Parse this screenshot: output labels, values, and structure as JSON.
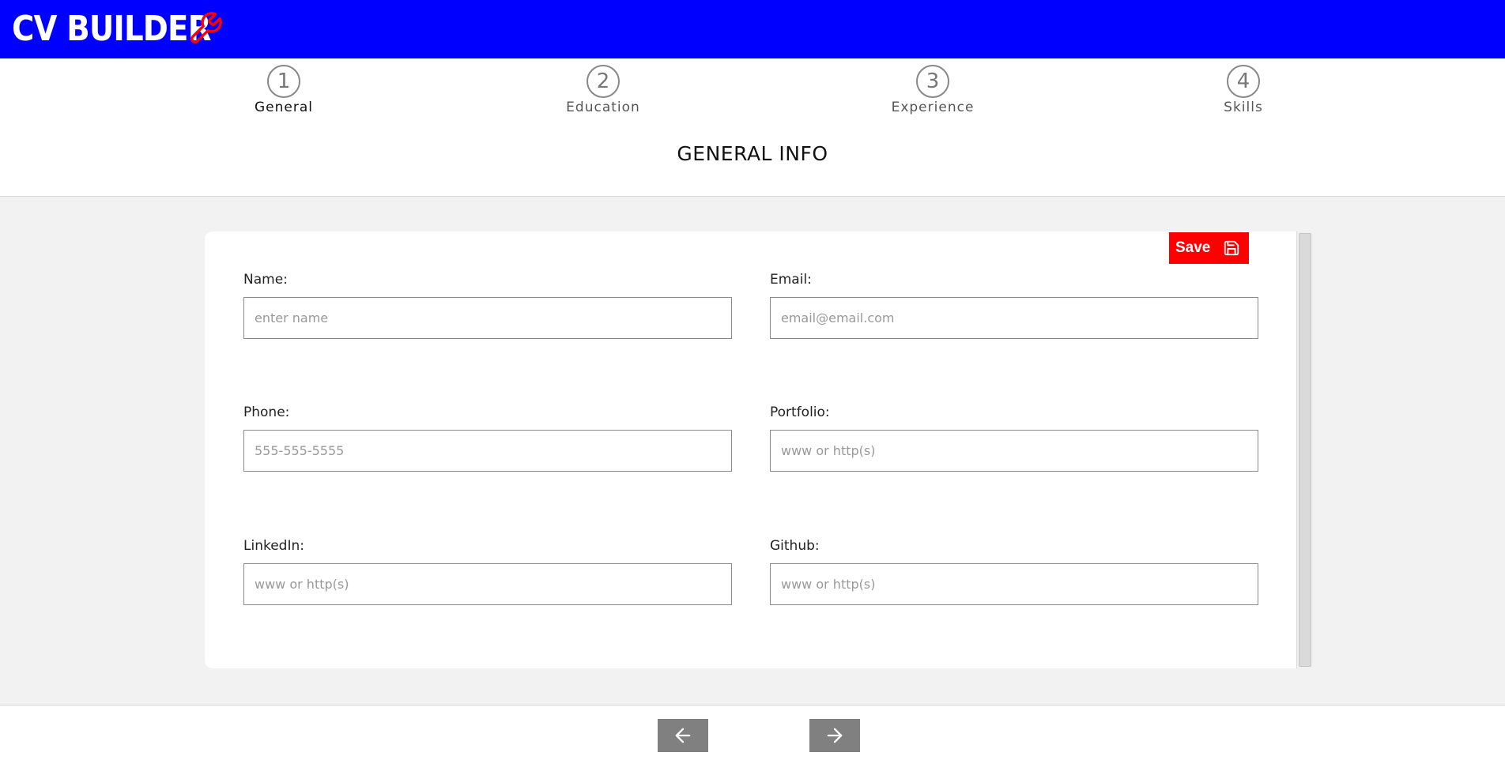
{
  "header": {
    "app_title": "CV BUILDER",
    "logo_icon": "wrench-icon",
    "background_color": "#0000ff",
    "accent_color": "#ff0000"
  },
  "steps": [
    {
      "number": "1",
      "label": "General",
      "active": true
    },
    {
      "number": "2",
      "label": "Education",
      "active": false
    },
    {
      "number": "3",
      "label": "Experience",
      "active": false
    },
    {
      "number": "4",
      "label": "Skills",
      "active": false
    }
  ],
  "section_title": "GENERAL INFO",
  "form": {
    "save_label": "Save",
    "save_icon": "floppy-disk-icon",
    "save_color": "#ff0000",
    "fields": {
      "name": {
        "label": "Name:",
        "placeholder": "enter name",
        "value": ""
      },
      "email": {
        "label": "Email:",
        "placeholder": "email@email.com",
        "value": ""
      },
      "phone": {
        "label": "Phone:",
        "placeholder": "555-555-5555",
        "value": ""
      },
      "portfolio": {
        "label": "Portfolio:",
        "placeholder": "www or http(s)",
        "value": ""
      },
      "linkedin": {
        "label": "LinkedIn:",
        "placeholder": "www or http(s)",
        "value": ""
      },
      "github": {
        "label": "Github:",
        "placeholder": "www or http(s)",
        "value": ""
      }
    }
  },
  "navigation": {
    "prev_icon": "arrow-left-icon",
    "next_icon": "arrow-right-icon"
  }
}
